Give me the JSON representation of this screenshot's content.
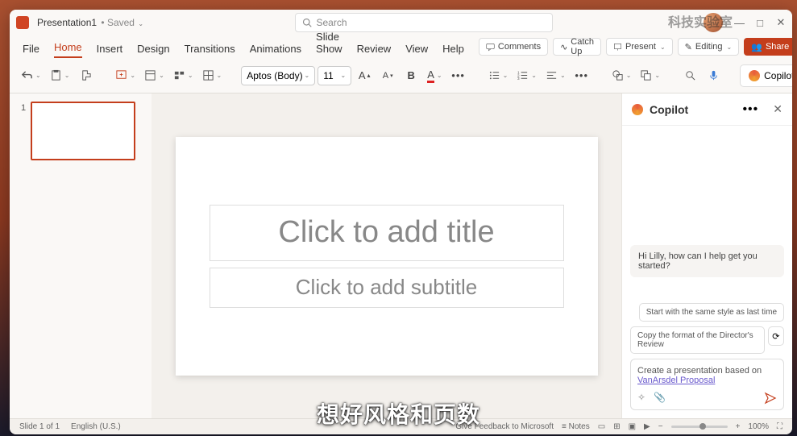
{
  "titlebar": {
    "doc": "Presentation1",
    "saved": "• Saved",
    "search_ph": "Search"
  },
  "menus": [
    "File",
    "Home",
    "Insert",
    "Design",
    "Transitions",
    "Animations",
    "Slide Show",
    "Review",
    "View",
    "Help"
  ],
  "active_menu": 1,
  "topright": {
    "comments": "Comments",
    "catchup": "Catch Up",
    "present": "Present",
    "editing": "Editing",
    "share": "Share"
  },
  "ribbon": {
    "font": "Aptos (Body)",
    "size": "11",
    "copilot": "Copilot"
  },
  "slide": {
    "title_ph": "Click to add title",
    "sub_ph": "Click to add subtitle"
  },
  "thumb_num": "1",
  "copilot": {
    "title": "Copilot",
    "greeting": "Hi Lilly, how can I help get you started?",
    "sugg1": "Start with the same style as last time",
    "sugg2": "Copy the format of the Director's Review",
    "compose_pre": "Create a presentation based on",
    "compose_link": "VanArsdel Proposal"
  },
  "status": {
    "slide": "Slide 1 of 1",
    "lang": "English (U.S.)",
    "feedback": "Give Feedback to Microsoft",
    "notes": "Notes",
    "zoom": "100%"
  },
  "caption": "想好风格和页数",
  "watermark": "科技实验室"
}
